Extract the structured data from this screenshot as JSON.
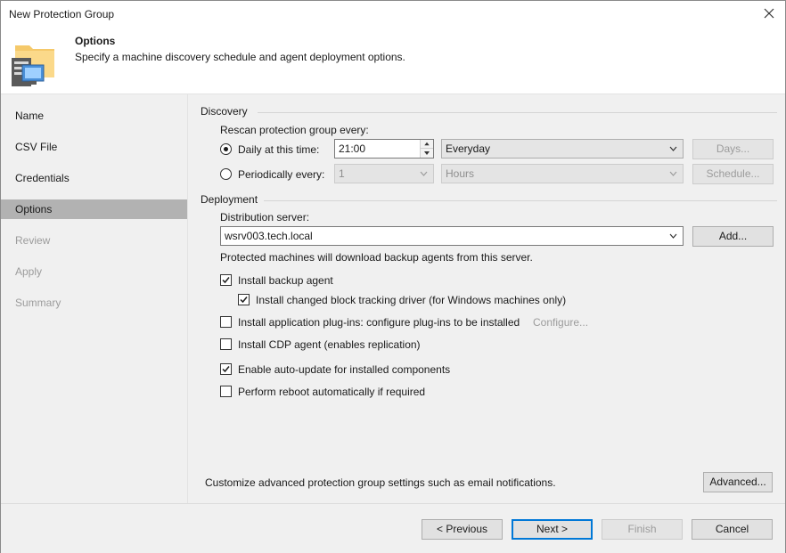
{
  "window": {
    "title": "New Protection Group"
  },
  "header": {
    "title": "Options",
    "subtitle": "Specify a machine discovery schedule and agent deployment options."
  },
  "nav": {
    "items": [
      {
        "label": "Name",
        "state": "normal"
      },
      {
        "label": "CSV File",
        "state": "normal"
      },
      {
        "label": "Credentials",
        "state": "normal"
      },
      {
        "label": "Options",
        "state": "active"
      },
      {
        "label": "Review",
        "state": "disabled"
      },
      {
        "label": "Apply",
        "state": "disabled"
      },
      {
        "label": "Summary",
        "state": "disabled"
      }
    ]
  },
  "discovery": {
    "group_label": "Discovery",
    "rescan_label": "Rescan protection group every:",
    "daily_label": "Daily at this time:",
    "daily_time": "21:00",
    "daily_select": "Everyday",
    "days_button": "Days...",
    "periodic_label": "Periodically every:",
    "periodic_value": "1",
    "periodic_unit": "Hours",
    "schedule_button": "Schedule..."
  },
  "deployment": {
    "group_label": "Deployment",
    "server_label": "Distribution server:",
    "server_value": "wsrv003.tech.local",
    "add_button": "Add...",
    "server_note": "Protected machines will download backup agents from this server.",
    "install_agent": "Install backup agent",
    "install_cbt": "Install changed block tracking driver (for Windows machines only)",
    "install_plugins": "Install application plug-ins: configure plug-ins to be installed",
    "configure_link": "Configure...",
    "install_cdp": "Install CDP agent (enables replication)",
    "auto_update": "Enable auto-update for installed components",
    "reboot": "Perform reboot automatically if required"
  },
  "advanced": {
    "note": "Customize advanced protection group settings such as email notifications.",
    "button": "Advanced..."
  },
  "footer": {
    "previous": "< Previous",
    "next": "Next >",
    "finish": "Finish",
    "cancel": "Cancel"
  },
  "colors": {
    "accent": "#0078d7",
    "nav_active": "#b2b2b2",
    "panel": "#f0f0f0"
  }
}
